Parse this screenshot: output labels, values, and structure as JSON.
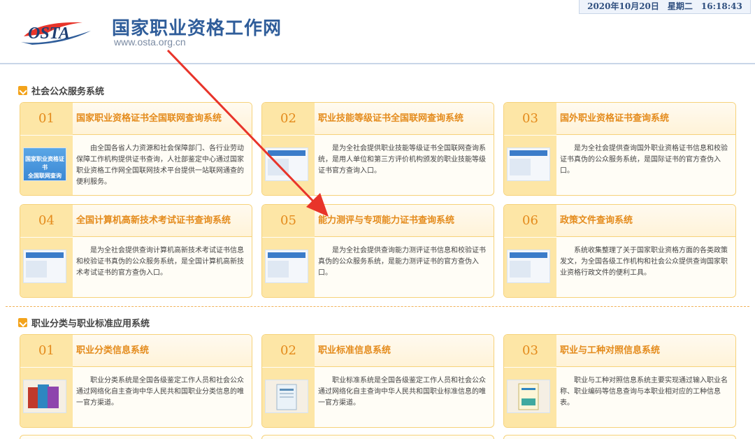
{
  "header": {
    "site_title": "国家职业资格工作网",
    "site_url": "www.osta.org.cn",
    "logo_text": "OSTA",
    "datetime": "2020年10月20日　星期二　16:18:43"
  },
  "section1": {
    "title": "社会公众服务系统",
    "cards": [
      {
        "num": "01",
        "title": "国家职业资格证书全国联网查询系统",
        "thumb_text": "国家职业资格证书\n全国联网查询",
        "desc": "由全国各省人力资源和社会保障部门、各行业劳动保障工作机构提供证书查询，人社部鉴定中心通过国家职业资格工作网全国联网技术平台提供一站联网通查的便利服务。"
      },
      {
        "num": "02",
        "title": "职业技能等级证书全国联网查询系统",
        "desc": "是为全社会提供职业技能等级证书全国联网查询系统，是用人单位和第三方评价机构颁发的职业技能等级证书官方查询入口。"
      },
      {
        "num": "03",
        "title": "国外职业资格证书查询系统",
        "desc": "是为全社会提供查询国外职业资格证书信息和校验证书真伪的公众服务系统，是国际证书的官方查伪入口。"
      },
      {
        "num": "04",
        "title": "全国计算机高新技术考试证书查询系统",
        "desc": "是为全社会提供查询计算机高新技术考试证书信息和校验证书真伪的公众服务系统，是全国计算机高新技术考试证书的官方查伪入口。"
      },
      {
        "num": "05",
        "title": "能力测评与专项能力证书查询系统",
        "desc": "是为全社会提供查询能力测评证书信息和校验证书真伪的公众服务系统，是能力测评证书的官方查伪入口。"
      },
      {
        "num": "06",
        "title": "政策文件查询系统",
        "desc": "系统收集整理了关于国家职业资格方面的各类政策发文，为全国各级工作机构和社会公众提供查询国家职业资格行政文件的便利工具。"
      }
    ]
  },
  "section2": {
    "title": "职业分类与职业标准应用系统",
    "cards": [
      {
        "num": "01",
        "title": "职业分类信息系统",
        "desc": "职业分类系统是全国各级鉴定工作人员和社会公众通过网络化自主查询中华人民共和国职业分类信息的唯一官方渠道。"
      },
      {
        "num": "02",
        "title": "职业标准信息系统",
        "desc": "职业标准系统是全国各级鉴定工作人员和社会公众通过网络化自主查询中华人民共和国职业标准信息的唯一官方渠道。"
      },
      {
        "num": "03",
        "title": "职业与工种对照信息系统",
        "desc": "职业与工种对照信息系统主要实现通过输入职业名称、职业编码等信息查询与本职业相对应的工种信息表。"
      }
    ]
  },
  "colors": {
    "accent": "#e48b1c",
    "card_border": "#f6d27a",
    "card_left": "#fde6a6",
    "title_blue": "#2f5d9a",
    "arrow_red": "#e8342a"
  }
}
